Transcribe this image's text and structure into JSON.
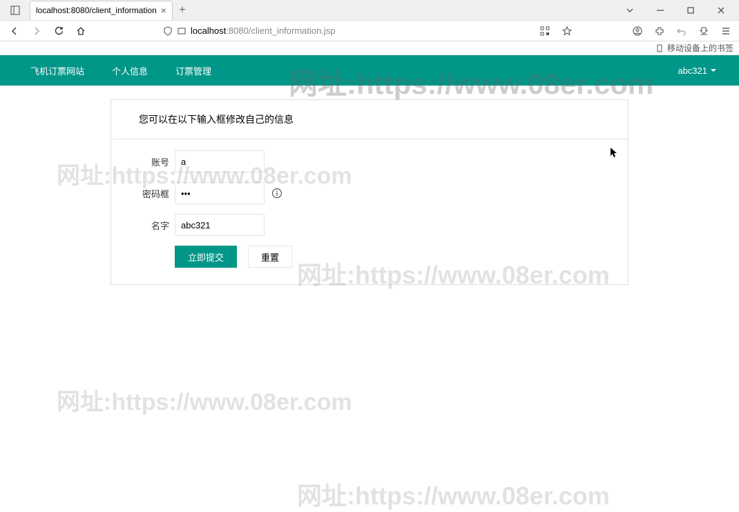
{
  "browser": {
    "tab_title": "localhost:8080/client_information",
    "url_host": "localhost",
    "url_port": ":8080",
    "url_path": "/client_information.jsp",
    "bookmark_hint": "移动设备上的书签"
  },
  "nav": {
    "items": [
      "飞机订票网站",
      "个人信息",
      "订票管理"
    ],
    "user": "abc321"
  },
  "card": {
    "heading": "您可以在以下输入框修改自己的信息",
    "fields": {
      "account_label": "账号",
      "account_value": "a",
      "password_label": "密码框",
      "password_value": "•••",
      "name_label": "名字",
      "name_value": "abc321"
    },
    "actions": {
      "submit": "立即提交",
      "reset": "重置"
    }
  },
  "watermark": {
    "text": "网址:https://www.08er.com"
  }
}
